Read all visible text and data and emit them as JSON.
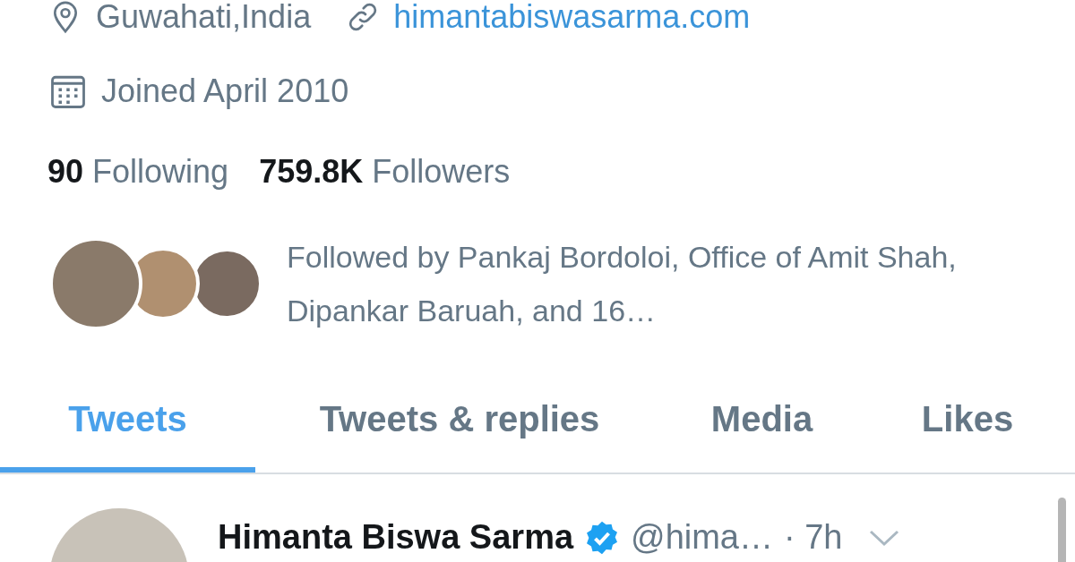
{
  "profile": {
    "location": "Guwahati,India",
    "website": "himantabiswasarma.com",
    "joined": "Joined April 2010",
    "following_count": "90",
    "following_label": "Following",
    "followers_count": "759.8K",
    "followers_label": "Followers",
    "followed_by": "Followed by Pankaj Bordoloi, Office of Amit Shah, Dipankar Baruah, and 16…"
  },
  "tabs": [
    {
      "label": "Tweets",
      "selected": true
    },
    {
      "label": "Tweets & replies",
      "selected": false
    },
    {
      "label": "Media",
      "selected": false
    },
    {
      "label": "Likes",
      "selected": false
    }
  ],
  "tweet": {
    "name": "Himanta Biswa Sarma",
    "verified": true,
    "handle": "@hima…",
    "time": "· 7h"
  }
}
